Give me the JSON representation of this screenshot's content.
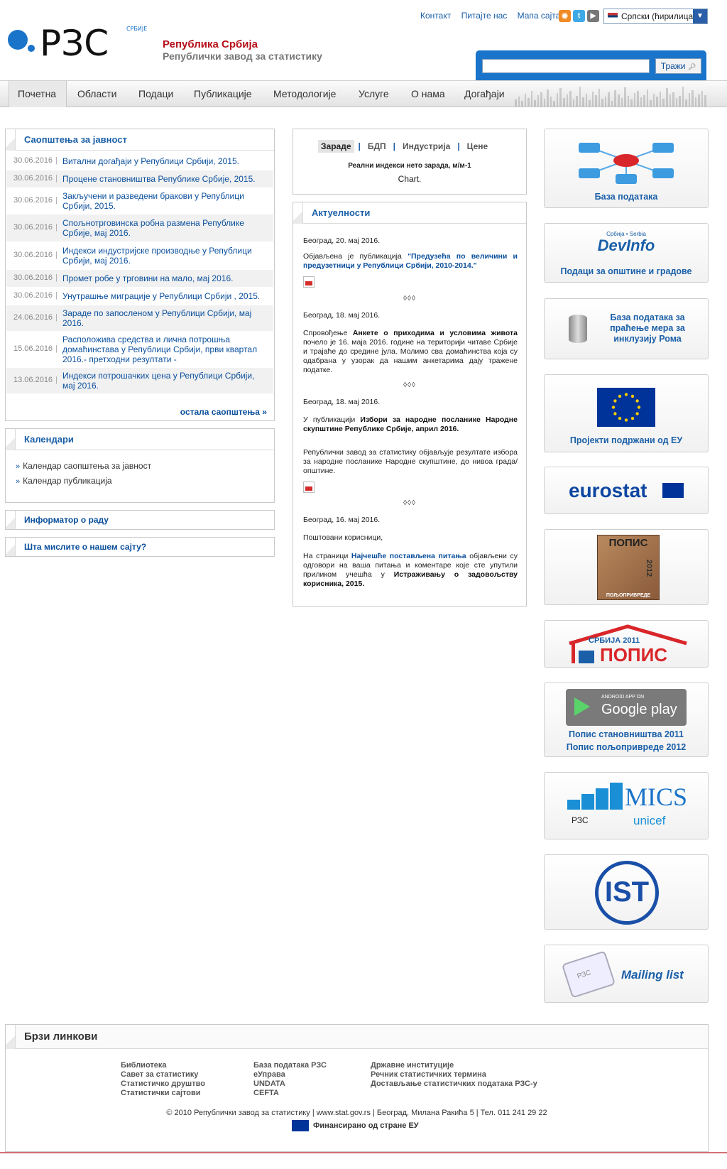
{
  "header": {
    "logo_text": "РЗС",
    "logo_small": "СРБИЈЕ",
    "brand_title": "Република Србија",
    "brand_subtitle": "Републички завод за статистику",
    "top_links": [
      "Контакт",
      "Питајте нас",
      "Мапа сајта"
    ],
    "social": [
      "rss-icon",
      "twitter-icon",
      "youtube-icon"
    ],
    "language": "Српски (ћирилица)",
    "search_placeholder": "",
    "search_button": "Тражи"
  },
  "nav": [
    "Почетна",
    "Области",
    "Подаци",
    "Публикације",
    "Методологије",
    "Услуге",
    "О нама",
    "Догађаји"
  ],
  "releases": {
    "title": "Саопштења за јавност",
    "items": [
      {
        "date": "30.06.2016",
        "title": "Витални догађаји у Републици Србији, 2015."
      },
      {
        "date": "30.06.2016",
        "title": "Процене становништва Републике Србије, 2015."
      },
      {
        "date": "30.06.2016",
        "title": "Закључени и разведени бракови у Републици Србији, 2015."
      },
      {
        "date": "30.06.2016",
        "title": "Спољнотрговинска робна размена Републике Србије, мај 2016."
      },
      {
        "date": "30.06.2016",
        "title": "Индекси индустријске производње у Републици Србији, мај 2016."
      },
      {
        "date": "30.06.2016",
        "title": "Промет робе у трговини на мало, мај 2016."
      },
      {
        "date": "30.06.2016",
        "title": "Унутрашње миграције у Републици Србији , 2015."
      },
      {
        "date": "24.06.2016",
        "title": "Зараде по запосленом у Републици Србији, мај 2016."
      },
      {
        "date": "15.06.2016",
        "title": "Расположива средства и лична потрошња домаћинстава у Републици Србији, први квартал 2016.- претходни резултати -"
      },
      {
        "date": "13.06.2016",
        "title": "Индекси потрошачких цена у Републици Србији, мај 2016."
      }
    ],
    "more": "остала саопштења"
  },
  "calendars": {
    "title": "Календари",
    "items": [
      "Календар саопштења за јавност",
      "Календар публикација"
    ]
  },
  "informator": "Информатор о раду",
  "opinion": "Шта мислите о нашем сајту?",
  "chart_panel": {
    "tabs": [
      "Зараде",
      "БДП",
      "Индустрија",
      "Цене"
    ],
    "selected": "Зараде",
    "subtitle": "Реални индекси нето зарада, м/м-1",
    "placeholder": "Chart."
  },
  "news": {
    "title": "Актуелности",
    "n1_date": "Београд, 20. мај 2016.",
    "n1_pre": "Објављена је публикација ",
    "n1_link": "\"Предузећа по величини и предузетници у Републици Србији, 2010-2014.\"",
    "sep": "◊◊◊",
    "n2_date": "Београд, 18. мај 2016.",
    "n2_pre": "Спровођење ",
    "n2_bold": "Анкете о приходима и условима живота",
    "n2_post": " почело је 16. маја 2016. године на територији читаве Србије и трајаће до средине јула. Молимо сва домаћинства која су одабрана у узорак да нашим анкетарима дају тражене податке.",
    "n3_date": "Београд, 18. мај 2016.",
    "n3_pre": "У публикацији ",
    "n3_bold": "Избори за народне посланике Народне скупштине Републике Србије, април 2016.",
    "n3_para": "Републички завод за статистику објављује резултате избора за народне посланике Народне скупштине, до нивоа града/општине.",
    "n4_date": "Београд, 16. мај 2016.",
    "n4_greet": "Поштовани корисници,",
    "n4_pre": "На страници ",
    "n4_link": "Најчешће постављена питања",
    "n4_mid": " објављени су одговори на ваша питања и коментаре које сте упутили приликом учешћа у ",
    "n4_bold": "Истраживању о задовољству корисника, 2015."
  },
  "right": {
    "database": "База података",
    "devinfo_small": "Србија • Serbia",
    "devinfo": "DevInfo",
    "devinfo_label": "Подаци за општине и градове",
    "roma_label": "База података за праћење мера за инклузију Рома",
    "eu_label": "Пројекти подржани од ЕУ",
    "eurostat": "eurostat",
    "popis_pp_top": "ПОПИС",
    "popis_pp_year": "2012",
    "popis_pp_bottom": "ПОЉОПРИВРЕДЕ",
    "popis2011_top": "СРБИЈА 2011",
    "popis2011": "ПОПИС",
    "gp_small": "ANDROID APP ON",
    "gp_text": "Google play",
    "gp_label1": "Попис становништва 2011",
    "gp_label2": "Попис пољопривреде 2012",
    "mics": "MICS",
    "mics_rzs": "РЗС",
    "mics_unicef": "unicef",
    "ist": "IST",
    "mailing": "Mailing list",
    "mailing_rzs": "РЗС"
  },
  "footer": {
    "title": "Брзи линкови",
    "col1": [
      "Библиотека",
      "Савет за статистику",
      "Статистичко друштво",
      "Статистички сајтови"
    ],
    "col2": [
      "База података РЗС",
      "еУправа",
      "UNDATA",
      "CEFTA"
    ],
    "col3": [
      "Државне институције",
      "Речник статистичких термина",
      "Достављање статистичких података РЗС-у"
    ],
    "copyright": "© 2010 Републички завод за статистику | www.stat.gov.rs | Београд, Милана Ракића 5 | Тел. 011 241 29 22",
    "eu_fund": "Финансирано од стране ЕУ"
  }
}
